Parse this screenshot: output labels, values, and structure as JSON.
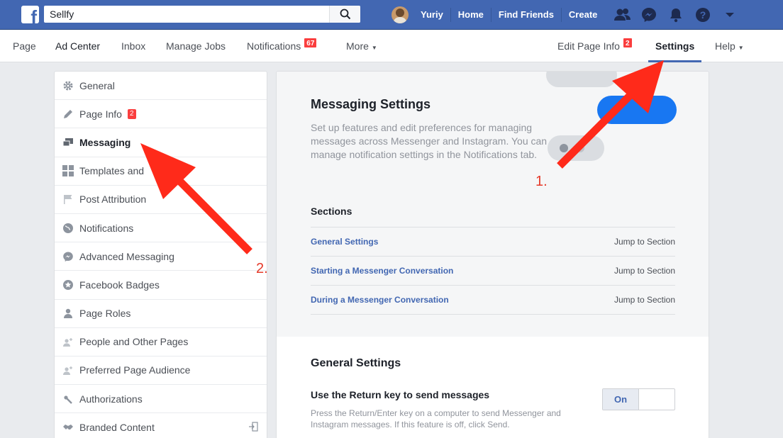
{
  "topbar": {
    "search_value": "Sellfy",
    "user_name": "Yuriy",
    "links": [
      "Home",
      "Find Friends",
      "Create"
    ]
  },
  "pagenav": {
    "items": [
      {
        "label": "Page"
      },
      {
        "label": "Ad Center"
      },
      {
        "label": "Inbox"
      },
      {
        "label": "Manage Jobs"
      },
      {
        "label": "Notifications",
        "badge": "67"
      },
      {
        "label": "More"
      }
    ],
    "right_items": [
      {
        "label": "Edit Page Info",
        "badge": "2"
      },
      {
        "label": "Settings"
      },
      {
        "label": "Help"
      }
    ]
  },
  "sidebar": {
    "items": [
      {
        "label": "General",
        "icon": "gear-icon"
      },
      {
        "label": "Page Info",
        "icon": "pencil-icon",
        "badge": "2"
      },
      {
        "label": "Messaging",
        "icon": "messaging-icon"
      },
      {
        "label": "Templates and",
        "icon": "grid-icon"
      },
      {
        "label": "Post Attribution",
        "icon": "flag-icon"
      },
      {
        "label": "Notifications",
        "icon": "globe-icon"
      },
      {
        "label": "Advanced Messaging",
        "icon": "messenger-icon"
      },
      {
        "label": "Facebook Badges",
        "icon": "star-icon"
      },
      {
        "label": "Page Roles",
        "icon": "person-icon"
      },
      {
        "label": "People and Other Pages",
        "icon": "people-icon"
      },
      {
        "label": "Preferred Page Audience",
        "icon": "audience-icon"
      },
      {
        "label": "Authorizations",
        "icon": "wrench-icon"
      },
      {
        "label": "Branded Content",
        "icon": "handshake-icon"
      }
    ]
  },
  "main": {
    "title": "Messaging Settings",
    "description": "Set up features and edit preferences for managing messages across Messenger and Instagram. You can manage notification settings in the Notifications tab.",
    "sections_title": "Sections",
    "sections": [
      {
        "name": "General Settings",
        "jump": "Jump to Section"
      },
      {
        "name": "Starting a Messenger Conversation",
        "jump": "Jump to Section"
      },
      {
        "name": "During a Messenger Conversation",
        "jump": "Jump to Section"
      }
    ],
    "general_title": "General Settings",
    "option_title": "Use the Return key to send messages",
    "option_desc": "Press the Return/Enter key on a computer to send Messenger and Instagram messages. If this feature is off, click Send.",
    "toggle_on": "On"
  },
  "annotations": {
    "label1": "1.",
    "label2": "2.",
    "color": "#ff2a1a"
  },
  "colors": {
    "brand_blue": "#4267b2",
    "link_blue": "#4267b2",
    "badge_red": "#fa3e3e"
  }
}
